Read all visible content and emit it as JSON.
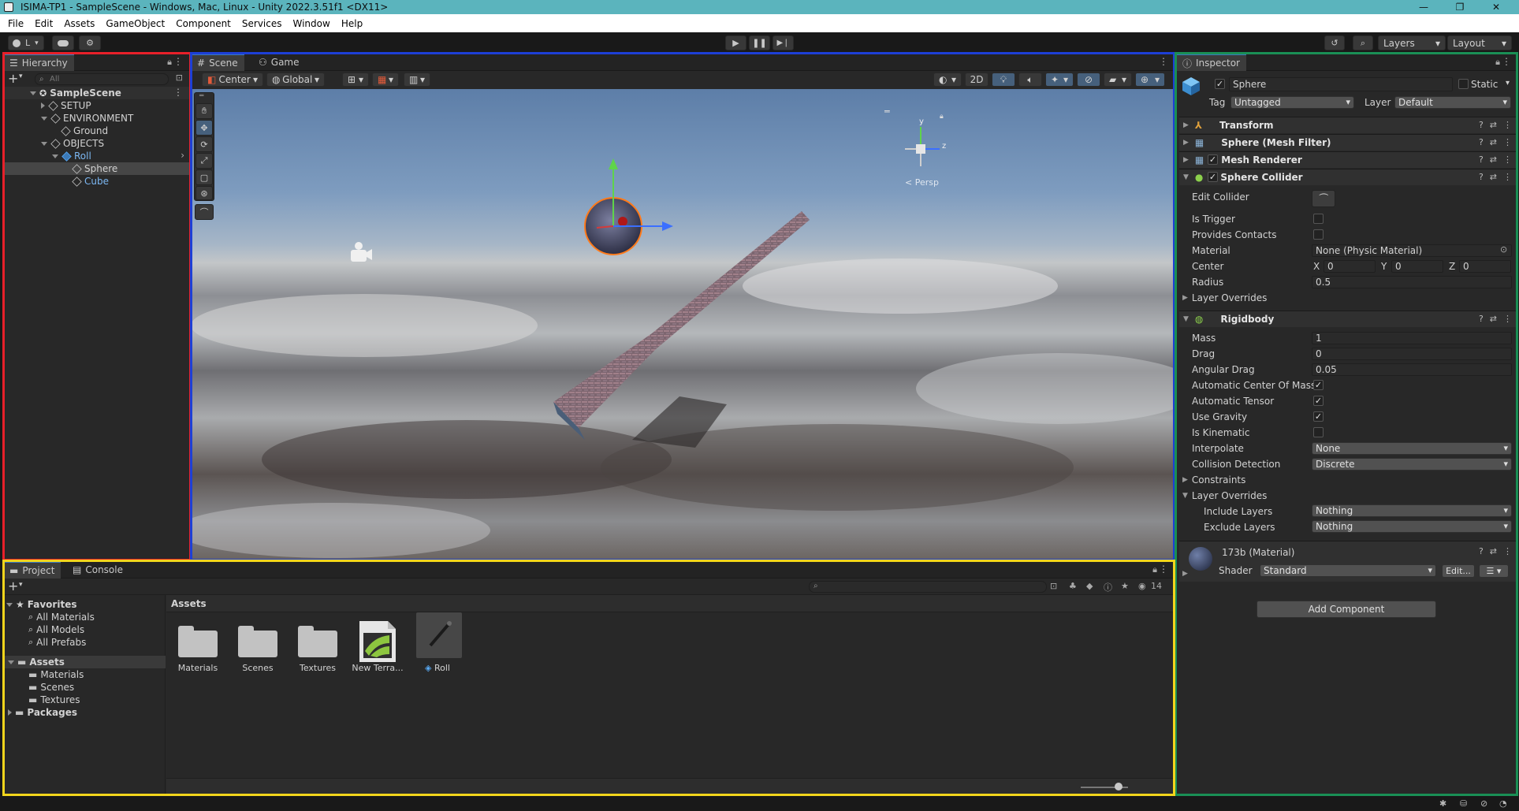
{
  "window": {
    "title": "ISIMA-TP1 - SampleScene - Windows, Mac, Linux - Unity 2022.3.51f1 <DX11>",
    "minimize": "—",
    "maximize": "❐",
    "close": "✕"
  },
  "menu": [
    "File",
    "Edit",
    "Assets",
    "GameObject",
    "Component",
    "Services",
    "Window",
    "Help"
  ],
  "toolbar": {
    "account": "L",
    "layers": "Layers",
    "layout": "Layout"
  },
  "hierarchy": {
    "tab": "Hierarchy",
    "search_placeholder": "All",
    "scene": "SampleScene",
    "items": [
      {
        "label": "SETUP"
      },
      {
        "label": "ENVIRONMENT"
      },
      {
        "label": "Ground"
      },
      {
        "label": "OBJECTS"
      },
      {
        "label": "Roll"
      },
      {
        "label": "Sphere"
      },
      {
        "label": "Cube"
      }
    ]
  },
  "scene_view": {
    "tabs": [
      "Scene",
      "Game"
    ],
    "pivot": "Center",
    "space": "Global",
    "mode_2d": "2D",
    "persp": "< Persp",
    "gizmo_y": "y",
    "gizmo_z": "z"
  },
  "inspector": {
    "tab": "Inspector",
    "object_name": "Sphere",
    "static_label": "Static",
    "tag_label": "Tag",
    "tag_value": "Untagged",
    "layer_label": "Layer",
    "layer_value": "Default",
    "components": {
      "transform": "Transform",
      "mesh_filter": "Sphere (Mesh Filter)",
      "mesh_renderer": "Mesh Renderer",
      "sphere_collider": "Sphere Collider",
      "rigidbody": "Rigidbody"
    },
    "collider": {
      "edit_collider": "Edit Collider",
      "is_trigger": "Is Trigger",
      "provides_contacts": "Provides Contacts",
      "material": "Material",
      "material_value": "None (Physic Material)",
      "center": "Center",
      "cx_label": "X",
      "cx": "0",
      "cy_label": "Y",
      "cy": "0",
      "cz_label": "Z",
      "cz": "0",
      "radius": "Radius",
      "radius_value": "0.5",
      "layer_overrides": "Layer Overrides"
    },
    "rigidbody": {
      "mass": "Mass",
      "mass_value": "1",
      "drag": "Drag",
      "drag_value": "0",
      "angular_drag": "Angular Drag",
      "angular_drag_value": "0.05",
      "auto_com": "Automatic Center Of Mass",
      "auto_tensor": "Automatic Tensor",
      "use_gravity": "Use Gravity",
      "is_kinematic": "Is Kinematic",
      "interpolate": "Interpolate",
      "interpolate_value": "None",
      "collision_detection": "Collision Detection",
      "collision_detection_value": "Discrete",
      "constraints": "Constraints",
      "layer_overrides": "Layer Overrides",
      "include_layers": "Include Layers",
      "include_value": "Nothing",
      "exclude_layers": "Exclude Layers",
      "exclude_value": "Nothing"
    },
    "material": {
      "name": "173b (Material)",
      "shader_label": "Shader",
      "shader_value": "Standard",
      "edit": "Edit..."
    },
    "add_component": "Add Component"
  },
  "project": {
    "tabs": [
      "Project",
      "Console"
    ],
    "favorites": "Favorites",
    "fav_items": [
      "All Materials",
      "All Models",
      "All Prefabs"
    ],
    "assets_root": "Assets",
    "asset_folders": [
      "Materials",
      "Scenes",
      "Textures"
    ],
    "packages": "Packages",
    "breadcrumb": "Assets",
    "hidden_count": "14",
    "grid": [
      {
        "label": "Materials"
      },
      {
        "label": "Scenes"
      },
      {
        "label": "Textures"
      },
      {
        "label": "New Terra..."
      },
      {
        "label": "Roll"
      }
    ]
  },
  "highlight_colors": {
    "hierarchy": "#e8202a",
    "scene": "#1d3fd6",
    "inspector": "#1a8f55",
    "project": "#f2d51c"
  }
}
